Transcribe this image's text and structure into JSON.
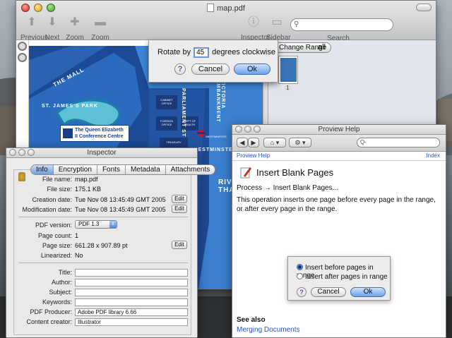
{
  "main_window": {
    "title": "map.pdf",
    "toolbar": {
      "previous": "Previous",
      "next": "Next",
      "zoom_in": "Zoom In",
      "zoom_out": "Zoom Out",
      "inspector": "Inspector",
      "sidebar": "Sidebar",
      "search": "Search"
    },
    "sidebar": {
      "change_range": "Change Range",
      "all_label": "all",
      "page_number": "1"
    },
    "map": {
      "labels": {
        "the_mall": "THE MALL",
        "st_james_park": "ST. JAMES'S PARK",
        "parliament_st": "PARLIAMENT ST",
        "victoria_embankment": "VICTORIA EMBANKMENT",
        "westminster": "WESTMINSTER B",
        "river_thames": "RIV THA",
        "cabinet_office": "CABINET OFFICE",
        "foreign_office": "FOREIGN OFFICE",
        "dept_of_health": "DEPT OF HEALTH",
        "treasury": "TREASURY",
        "westminster_small": "WESTMINSTER"
      },
      "callout": "The Queen Elizabeth II Conference Centre"
    }
  },
  "rotate_sheet": {
    "prefix": "Rotate by",
    "value": "45",
    "suffix": "degrees clockwise",
    "help": "?",
    "cancel": "Cancel",
    "ok": "Ok"
  },
  "inspector": {
    "title": "Inspector",
    "tabs": [
      "Info",
      "Encryption",
      "Fonts",
      "Metadata",
      "Attachments"
    ],
    "info": {
      "file_name_label": "File name:",
      "file_name": "map.pdf",
      "file_size_label": "File size:",
      "file_size": "175.1 KB",
      "creation_label": "Creation date:",
      "creation": "Tue Nov 08 13:45:49 GMT 2005",
      "modification_label": "Modification date:",
      "modification": "Tue Nov 08 13:45:49 GMT 2005",
      "edit": "Edit",
      "pdf_version_label": "PDF version:",
      "pdf_version": "PDF 1.3",
      "page_count_label": "Page count:",
      "page_count": "1",
      "page_size_label": "Page size:",
      "page_size": "661.28 x 907.89 pt",
      "linearized_label": "Linearized:",
      "linearized": "No",
      "title_label": "Title:",
      "author_label": "Author:",
      "subject_label": "Subject:",
      "keywords_label": "Keywords:",
      "producer_label": "PDF Producer:",
      "producer": "Adobe PDF library 6.66",
      "creator_label": "Content creator:",
      "creator": "Illustrator"
    }
  },
  "help_window": {
    "title": "Proview Help",
    "search_placeholder": "Q-",
    "crumb_left": "Proview Help",
    "crumb_right": "Index",
    "heading": "Insert Blank Pages",
    "path": "Process → Insert Blank Pages...",
    "description": "This operation inserts one page before every page in the range, or after every page in the range.",
    "dialog": {
      "option1": "Insert before pages in range",
      "option2": "Insert after pages in range",
      "help": "?",
      "cancel": "Cancel",
      "ok": "Ok"
    },
    "see_also": "See also",
    "link": "Merging Documents"
  }
}
